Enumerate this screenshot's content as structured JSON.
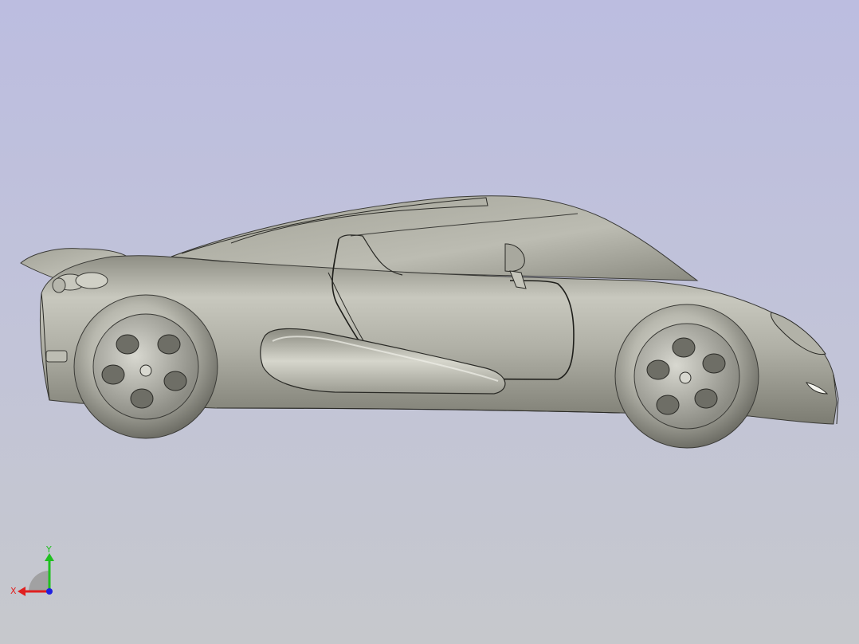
{
  "viewport": {
    "background_top": "#bcbde0",
    "background_bottom": "#c6c8cc",
    "model_color": "#a9a99e"
  },
  "triad": {
    "x_label": "X",
    "y_label": "Y",
    "x_color": "#e02020",
    "y_color": "#20c020",
    "z_color": "#2020e0"
  }
}
